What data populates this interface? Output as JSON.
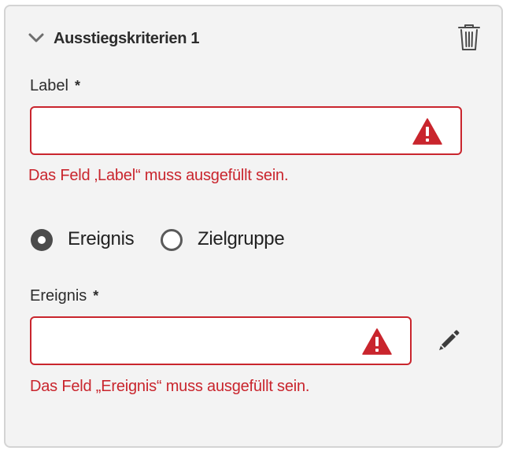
{
  "section": {
    "title": "Ausstiegskriterien 1",
    "expanded": true,
    "collapse_icon": "chevron-down-icon",
    "delete_icon": "trash-icon"
  },
  "label_field": {
    "label": "Label",
    "required_marker": "*",
    "value": "",
    "error": "Das Feld ‚Label“ muss ausgefüllt sein.",
    "status_icon": "alert-icon"
  },
  "criteria_type": {
    "options": [
      {
        "label": "Ereignis",
        "selected": true
      },
      {
        "label": "Zielgruppe",
        "selected": false
      }
    ]
  },
  "event_field": {
    "label": "Ereignis",
    "required_marker": "*",
    "value": "",
    "error": "Das Feld „Ereignis“ muss ausgefüllt sein.",
    "status_icon": "alert-icon",
    "edit_icon": "pencil-icon"
  },
  "colors": {
    "error": "#c9252d",
    "panel_background": "#f3f3f3",
    "panel_border": "#d4d4d4",
    "text": "#2c2c2c"
  }
}
